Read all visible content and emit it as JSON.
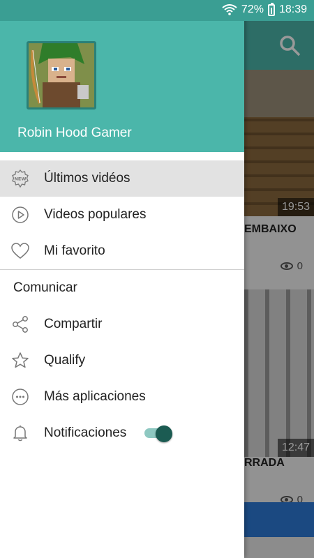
{
  "status_bar": {
    "battery": "72%",
    "time": "18:39"
  },
  "drawer": {
    "channel_name": "Robin Hood Gamer",
    "items": [
      {
        "label": "Últimos vidéos",
        "icon": "new-badge-icon",
        "active": true
      },
      {
        "label": "Videos populares",
        "icon": "play-circle-icon"
      },
      {
        "label": "Mi favorito",
        "icon": "heart-icon"
      }
    ],
    "section_title": "Comunicar",
    "communicate_items": [
      {
        "label": "Compartir",
        "icon": "share-icon"
      },
      {
        "label": "Qualify",
        "icon": "star-icon"
      },
      {
        "label": "Más aplicaciones",
        "icon": "more-apps-icon"
      },
      {
        "label": "Notificaciones",
        "icon": "bell-icon",
        "toggle": true
      }
    ]
  },
  "background": {
    "videos": [
      {
        "duration": "19:53",
        "title_fragment": "EMBAIXO",
        "views": "0"
      },
      {
        "duration": "12:47",
        "title_fragment": "RRADA",
        "views": "0"
      }
    ]
  },
  "colors": {
    "teal": "#4bb6aa",
    "teal_dark": "#3a9e93",
    "toggle_on": "#1b5b52"
  }
}
